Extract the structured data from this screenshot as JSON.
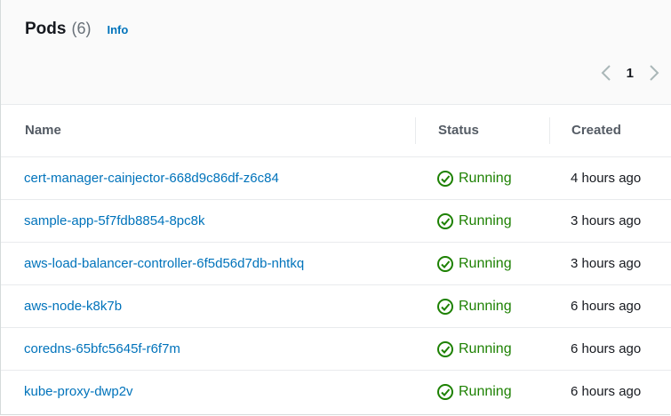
{
  "header": {
    "title": "Pods",
    "count": "(6)",
    "info_label": "Info"
  },
  "pagination": {
    "current_page": "1",
    "prev_icon": "chevron-left-icon",
    "next_icon": "chevron-right-icon"
  },
  "columns": {
    "name": "Name",
    "status": "Status",
    "created": "Created"
  },
  "colors": {
    "link": "#0073bb",
    "running": "#1d8102",
    "disabled_chevron": "#aab7b8"
  },
  "rows": [
    {
      "name": "cert-manager-cainjector-668d9c86df-z6c84",
      "status": "Running",
      "status_icon": "check-circle-icon",
      "created": "4 hours ago"
    },
    {
      "name": "sample-app-5f7fdb8854-8pc8k",
      "status": "Running",
      "status_icon": "check-circle-icon",
      "created": "3 hours ago"
    },
    {
      "name": "aws-load-balancer-controller-6f5d56d7db-nhtkq",
      "status": "Running",
      "status_icon": "check-circle-icon",
      "created": "3 hours ago"
    },
    {
      "name": "aws-node-k8k7b",
      "status": "Running",
      "status_icon": "check-circle-icon",
      "created": "6 hours ago"
    },
    {
      "name": "coredns-65bfc5645f-r6f7m",
      "status": "Running",
      "status_icon": "check-circle-icon",
      "created": "6 hours ago"
    },
    {
      "name": "kube-proxy-dwp2v",
      "status": "Running",
      "status_icon": "check-circle-icon",
      "created": "6 hours ago"
    }
  ]
}
